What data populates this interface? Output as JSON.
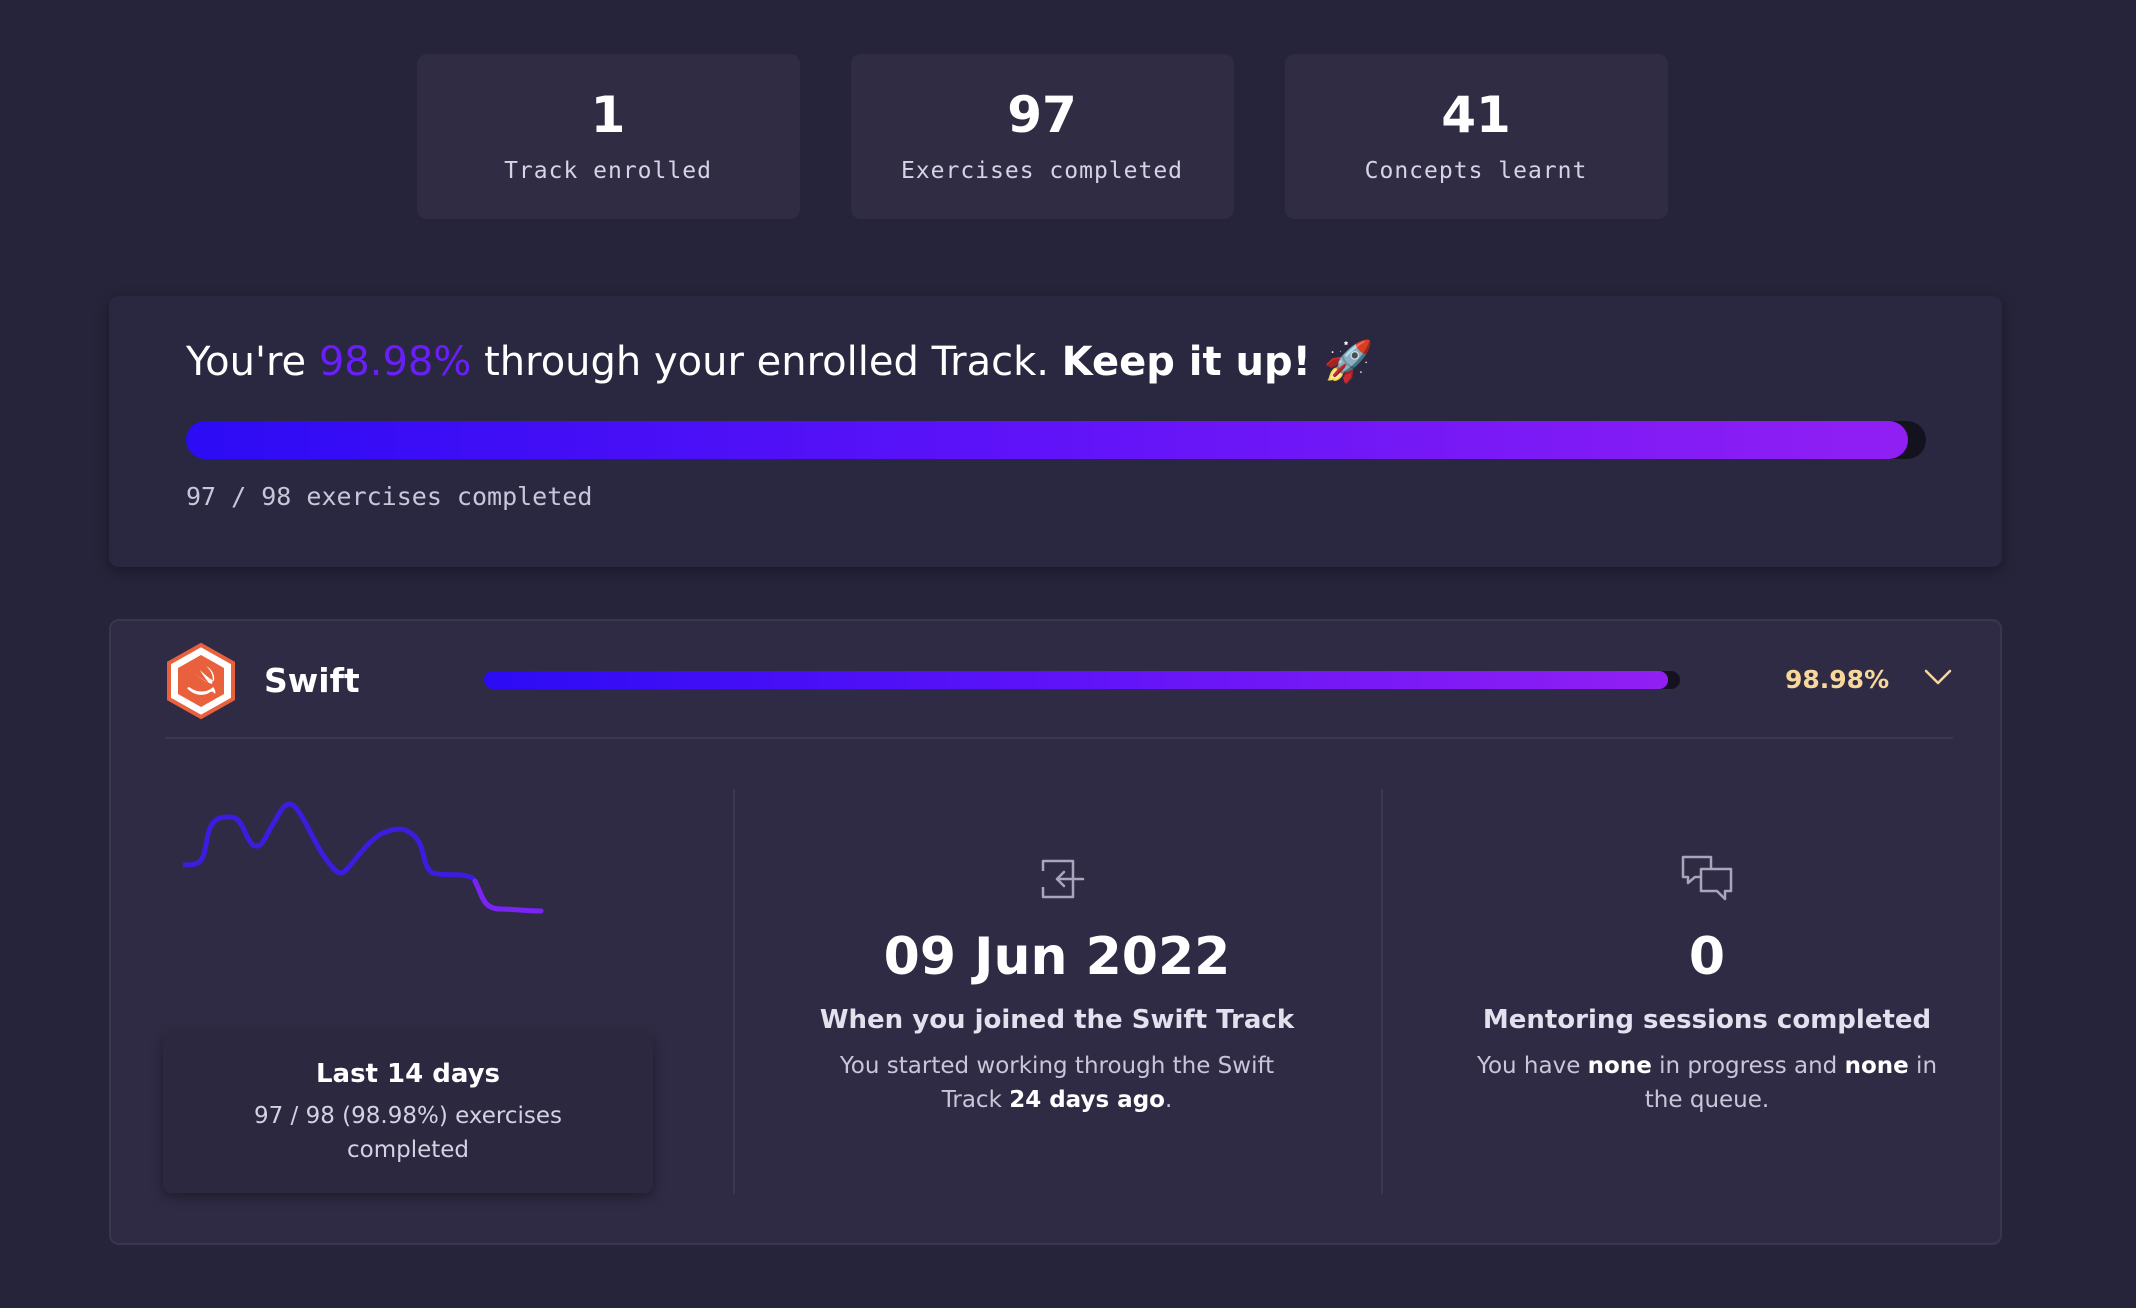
{
  "stats": [
    {
      "value": "1",
      "label": "Track enrolled"
    },
    {
      "value": "97",
      "label": "Exercises completed"
    },
    {
      "value": "41",
      "label": "Concepts learnt"
    }
  ],
  "progress": {
    "prefix": "You're ",
    "percent": "98.98%",
    "middle": " through your enrolled Track. ",
    "emphasis": "Keep it up!",
    "emoji": "🚀",
    "fraction": 0.9898,
    "exercises_text": "97 / 98 exercises completed",
    "accent": "#6a1ef9"
  },
  "track": {
    "name": "Swift",
    "percent": "98.98%",
    "fraction": 0.9898,
    "logo_icon": "swift-logo-icon",
    "expand_icon": "chevron-down-icon",
    "percent_color": "#f7d79b"
  },
  "activity": {
    "title": "Last 14 days",
    "description": "97 / 98 (98.98%) exercises completed"
  },
  "joined": {
    "icon": "enter-icon",
    "date": "09 Jun 2022",
    "title": "When you joined the Swift Track",
    "desc_start": "You started working through the Swift Track ",
    "desc_bold": "24 days ago",
    "desc_end": "."
  },
  "mentoring": {
    "icon": "chat-bubbles-icon",
    "count": "0",
    "title": "Mentoring sessions completed",
    "desc_1": "You have ",
    "desc_bold_1": "none",
    "desc_2": " in progress and ",
    "desc_bold_2": "none",
    "desc_3": " in the queue."
  }
}
